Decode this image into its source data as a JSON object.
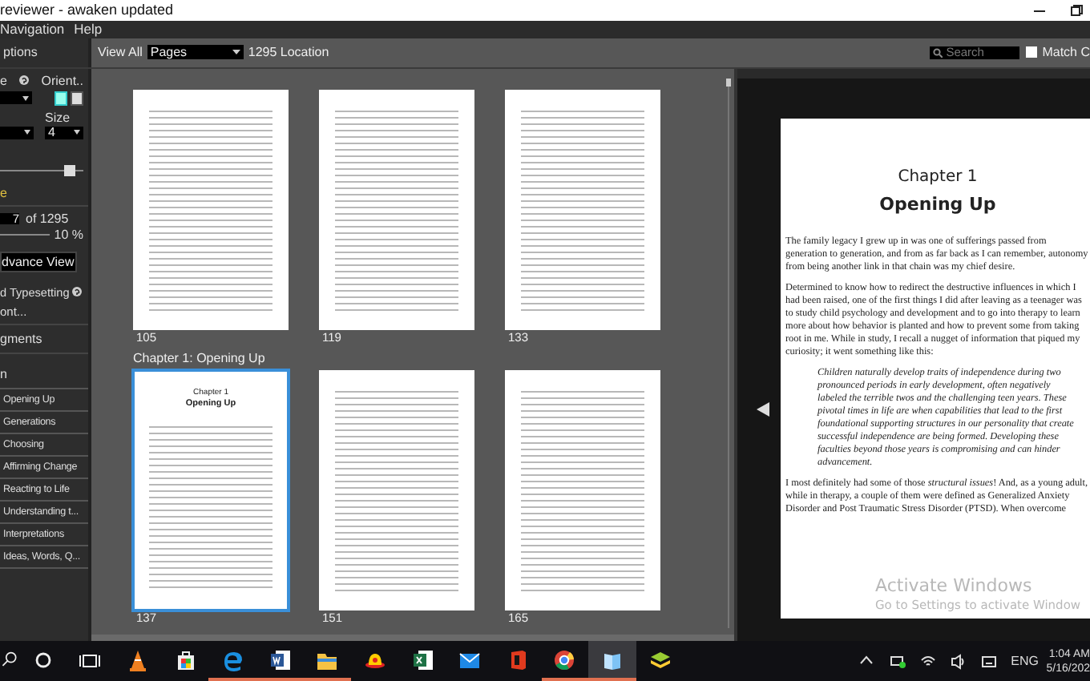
{
  "window": {
    "title": "reviewer - awaken updated"
  },
  "menu": [
    {
      "label": "Navigation"
    },
    {
      "label": "Help"
    }
  ],
  "options": {
    "header": "ptions",
    "setting_label": "e",
    "orient_label": "Orient..",
    "orientations": [
      {
        "selected": true
      },
      {
        "selected": false
      }
    ],
    "size_label": "Size",
    "size_value": "4",
    "slider": {
      "level": 0.85
    },
    "note": "e",
    "page": {
      "value": "7",
      "total": "of 1295"
    },
    "zoom": {
      "reading": "10 %"
    },
    "advance_button": "dvance View",
    "typesetting": "d Typesetting",
    "font_link": "ont...",
    "segments_header": "gments"
  },
  "chapters": {
    "header": "n",
    "items": [
      "Opening Up",
      "Generations",
      "Choosing",
      "Affirming Change",
      "Reacting to Life",
      "Understanding t...",
      "Interpretations",
      "Ideas, Words, Q..."
    ]
  },
  "toolbar": {
    "view_label": "View All",
    "view_select": "Pages",
    "location": "1295 Location",
    "search": {
      "placeholder": "Search"
    },
    "match_case": {
      "label": "Match C",
      "checked": false
    }
  },
  "thumbnails": [
    {
      "page": "105",
      "selected": false
    },
    {
      "page": "119",
      "selected": false
    },
    {
      "page": "133",
      "selected": false
    },
    {
      "page": "137",
      "selected": true,
      "chapter_label": "Chapter 1: Opening Up",
      "heading": [
        "Chapter 1",
        "Opening Up"
      ]
    },
    {
      "page": "151",
      "selected": false
    },
    {
      "page": "165",
      "selected": false
    }
  ],
  "reader": {
    "chapter": "Chapter 1",
    "title": "Opening Up",
    "paragraphs": [
      {
        "kind": "body",
        "text": "The family legacy I grew up in was one of sufferings passed from generation to generation, and from as far back as I can remember, autonomy from being another link in that chain was my chief desire."
      },
      {
        "kind": "body",
        "text": "Determined to know how to redirect the destructive influences in which I had been raised, one of the first things I did after leaving as a teenager was to study child psychology and development and to go into therapy to learn more about how behavior is planted and how to prevent some from taking root in me. While in study, I recall a nugget of information that piqued my curiosity; it went something like this:"
      },
      {
        "kind": "quote",
        "text": "Children naturally develop traits of independence during two pronounced periods in early development, often negatively labeled the terrible twos and the challenging teen years. These pivotal times in life are when capabilities that lead to the first foundational supporting structures in our personality that create successful independence are being formed. Developing these faculties beyond those years is compromising and can hinder advancement."
      },
      {
        "kind": "body",
        "text": "I most definitely had some of those *structural issues*! And, as a young adult, while in therapy, a couple of them were defined as Generalized Anxiety Disorder and Post Traumatic Stress Disorder (PTSD). When overcome"
      }
    ]
  },
  "activation_notice": {
    "title": "Activate Windows",
    "hint": "Go to Settings to activate Window"
  },
  "taskbar": {
    "apps": [
      {
        "running": false,
        "selected": false
      },
      {
        "running": false,
        "selected": false
      },
      {
        "running": true,
        "selected": false
      },
      {
        "running": true,
        "selected": false
      },
      {
        "running": true,
        "selected": false
      },
      {
        "running": false,
        "selected": false
      },
      {
        "running": false,
        "selected": false
      },
      {
        "running": false,
        "selected": false
      },
      {
        "running": false,
        "selected": false
      },
      {
        "running": true,
        "selected": false
      },
      {
        "running": true,
        "selected": true
      },
      {
        "running": false,
        "selected": false
      }
    ],
    "language": "ENG",
    "time": "1:04 AM",
    "date": "5/16/202"
  }
}
